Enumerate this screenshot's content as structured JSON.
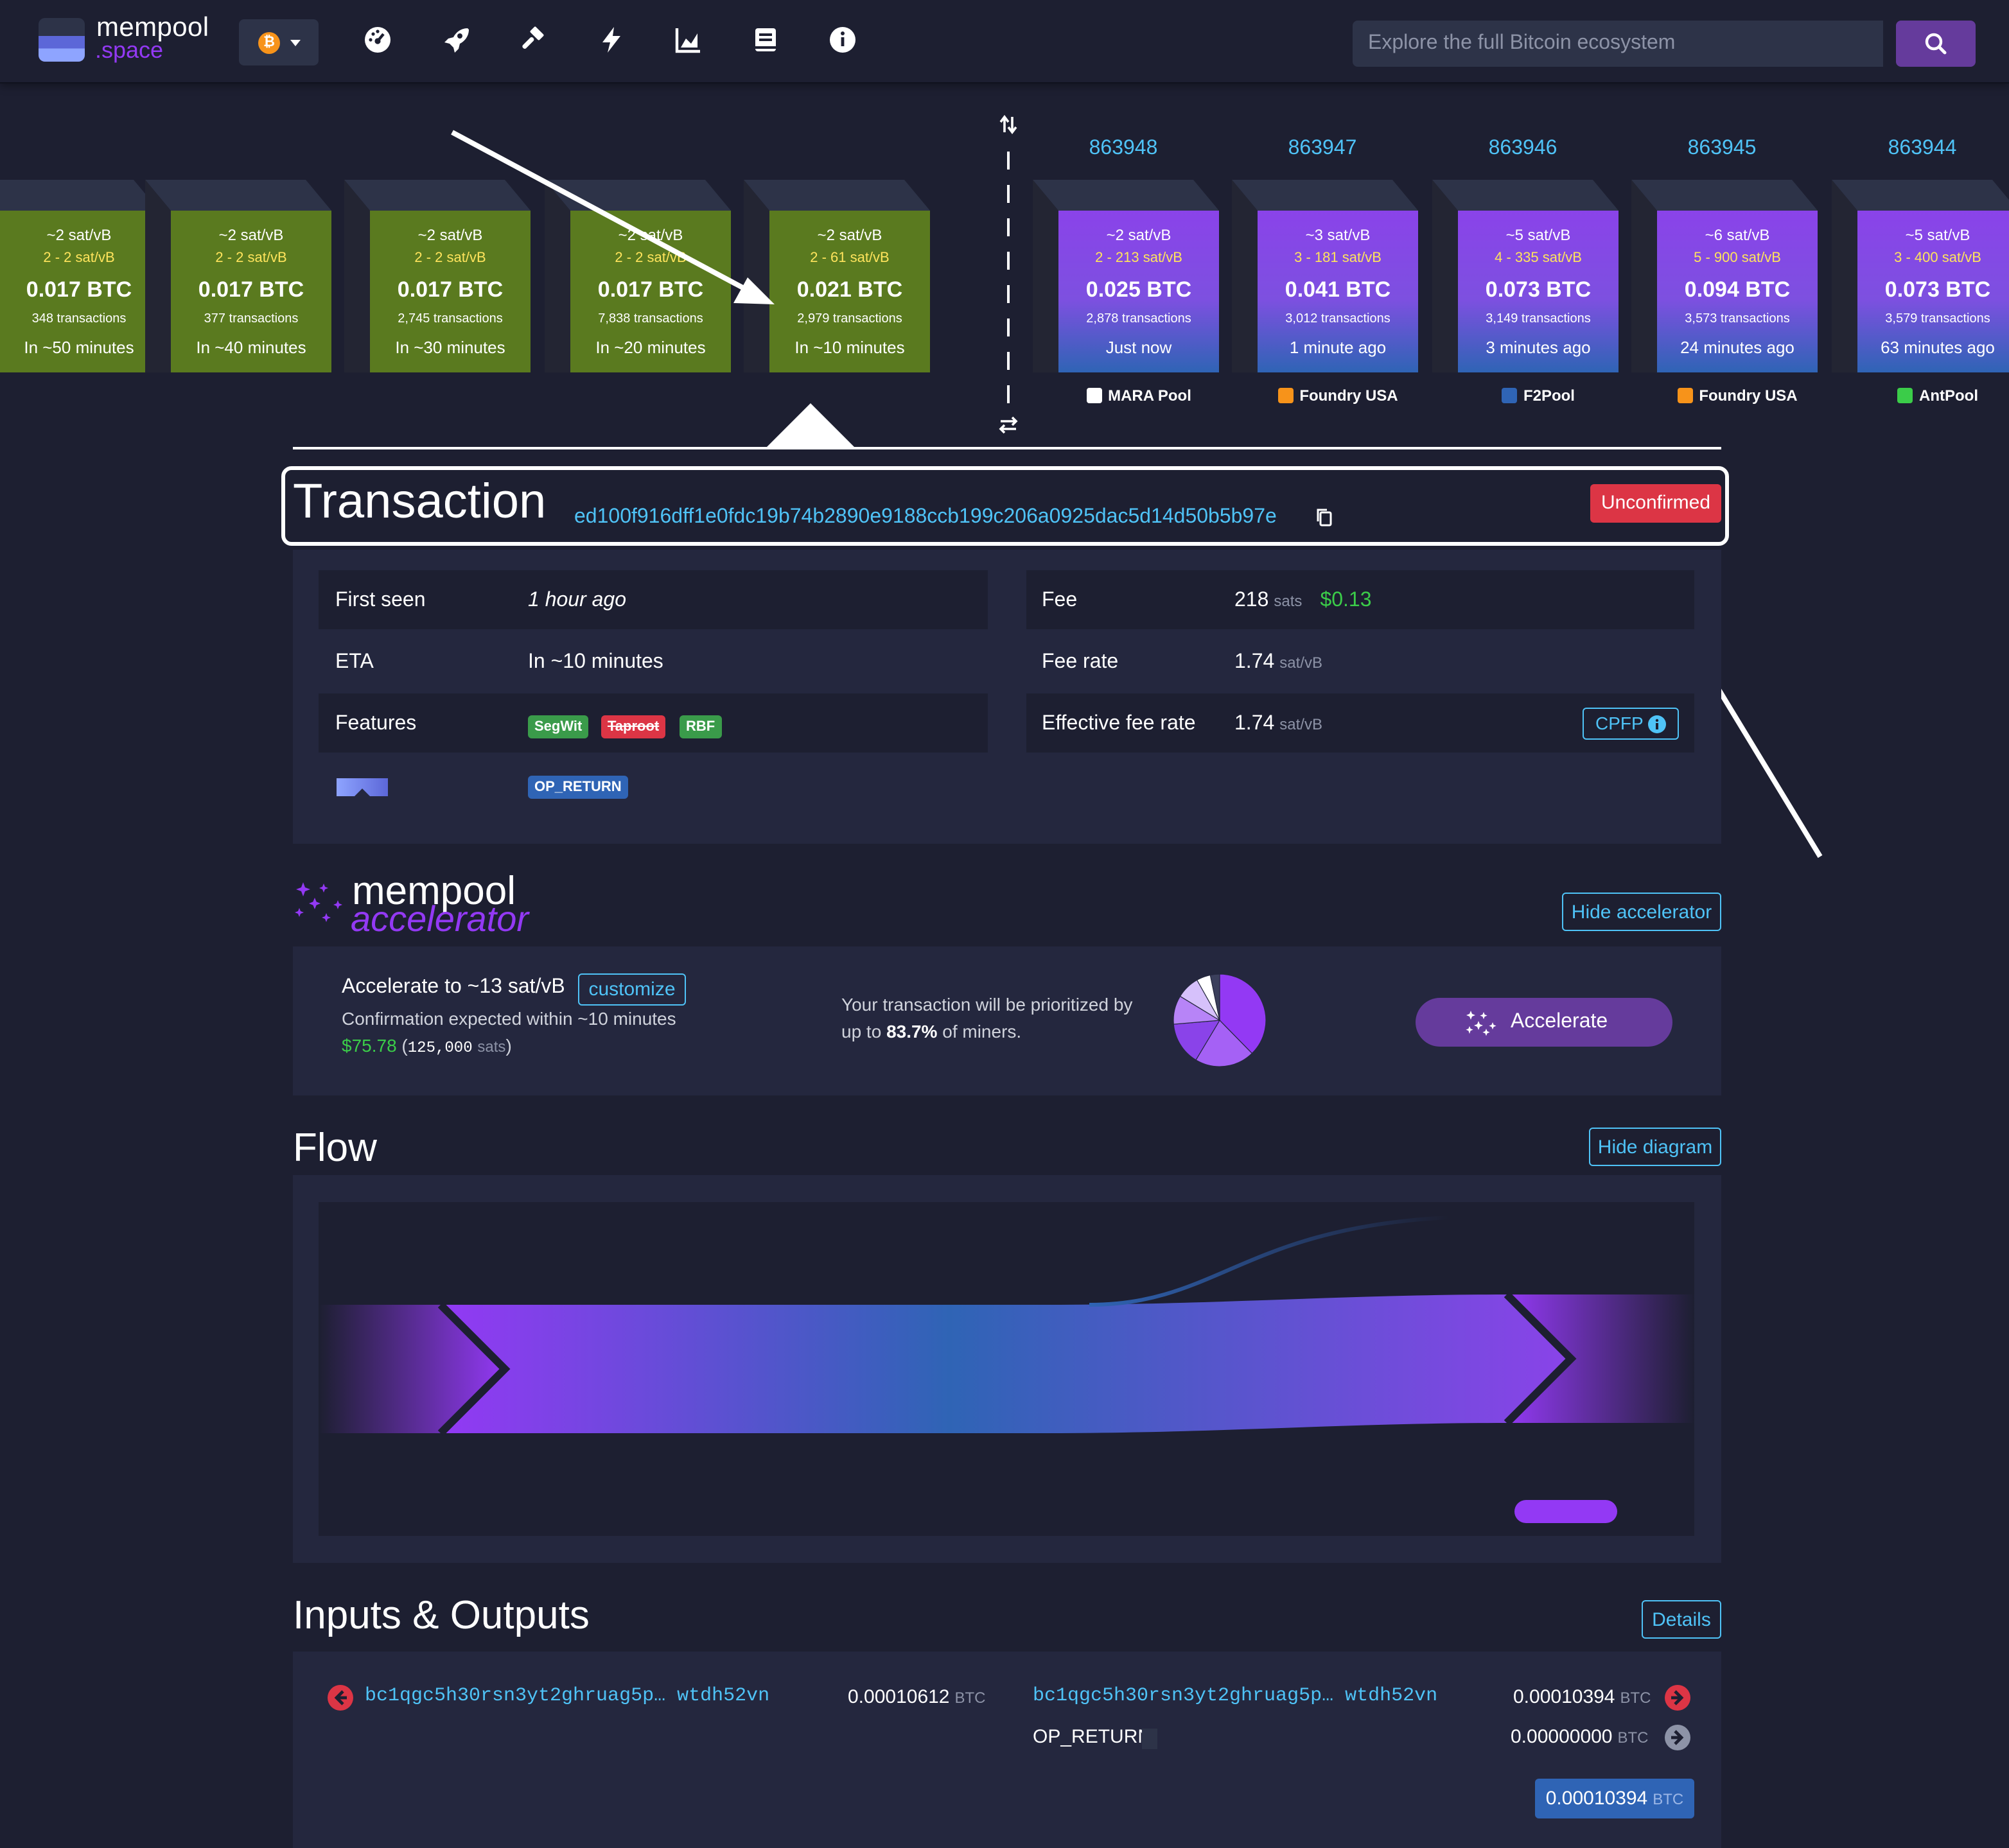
{
  "nav": {
    "logo_line1": "mempool",
    "logo_line2": ".space",
    "network_symbol": "₿",
    "icons": [
      "dashboard-icon",
      "rocket-icon",
      "hammer-icon",
      "lightning-icon",
      "chart-icon",
      "docs-icon",
      "info-icon"
    ],
    "search_placeholder": "Explore the full Bitcoin ecosystem"
  },
  "mempool_blocks": [
    {
      "median": "~2 sat/vB",
      "range": "2 - 2 sat/vB",
      "size": "0.017 BTC",
      "txs": "348 transactions",
      "eta": "In ~50 minutes"
    },
    {
      "median": "~2 sat/vB",
      "range": "2 - 2 sat/vB",
      "size": "0.017 BTC",
      "txs": "377 transactions",
      "eta": "In ~40 minutes"
    },
    {
      "median": "~2 sat/vB",
      "range": "2 - 2 sat/vB",
      "size": "0.017 BTC",
      "txs": "2,745 transactions",
      "eta": "In ~30 minutes"
    },
    {
      "median": "~2 sat/vB",
      "range": "2 - 2 sat/vB",
      "size": "0.017 BTC",
      "txs": "7,838 transactions",
      "eta": "In ~20 minutes"
    },
    {
      "median": "~2 sat/vB",
      "range": "2 - 61 sat/vB",
      "size": "0.021 BTC",
      "txs": "2,979 transactions",
      "eta": "In ~10 minutes"
    }
  ],
  "mined_blocks": [
    {
      "height": "863948",
      "median": "~2 sat/vB",
      "range": "2 - 213 sat/vB",
      "size": "0.025 BTC",
      "txs": "2,878 transactions",
      "time": "Just now",
      "pool": "MARA Pool"
    },
    {
      "height": "863947",
      "median": "~3 sat/vB",
      "range": "3 - 181 sat/vB",
      "size": "0.041 BTC",
      "txs": "3,012 transactions",
      "time": "1 minute ago",
      "pool": "Foundry USA"
    },
    {
      "height": "863946",
      "median": "~5 sat/vB",
      "range": "4 - 335 sat/vB",
      "size": "0.073 BTC",
      "txs": "3,149 transactions",
      "time": "3 minutes ago",
      "pool": "F2Pool"
    },
    {
      "height": "863945",
      "median": "~6 sat/vB",
      "range": "5 - 900 sat/vB",
      "size": "0.094 BTC",
      "txs": "3,573 transactions",
      "time": "24 minutes ago",
      "pool": "Foundry USA"
    },
    {
      "height": "863944",
      "median": "~5 sat/vB",
      "range": "3 - 400 sat/vB",
      "size": "0.073 BTC",
      "txs": "3,579 transactions",
      "time": "63 minutes ago",
      "pool": "AntPool"
    }
  ],
  "transaction": {
    "title": "Transaction",
    "txid": "ed100f916dff1e0fdc19b74b2890e9188ccb199c206a0925dac5d14d50b5b97e",
    "status": "Unconfirmed",
    "first_seen_label": "First seen",
    "first_seen": "1 hour ago",
    "eta_label": "ETA",
    "eta": "In ~10 minutes",
    "features_label": "Features",
    "features": [
      "SegWit",
      "Taproot",
      "RBF"
    ],
    "op_return": "OP_RETURN",
    "fee_label": "Fee",
    "fee": "218",
    "fee_unit": "sats",
    "fee_usd": "$0.13",
    "fee_rate_label": "Fee rate",
    "fee_rate": "1.74",
    "rate_unit": "sat/vB",
    "eff_rate_label": "Effective fee rate",
    "eff_rate": "1.74",
    "cpfp": "CPFP"
  },
  "accelerator": {
    "brand1": "mempool",
    "brand2": "accelerator",
    "hide_button": "Hide accelerator",
    "accelerate_to": "Accelerate to ~13 sat/vB",
    "customize": "customize",
    "confirmation": "Confirmation expected within ~10 minutes",
    "price_usd": "$75.78",
    "price_sats": "125,000",
    "price_sats_unit": "sats",
    "prio_text": "Your transaction will be prioritized by",
    "prio_pre": "up to",
    "prio_pct": "83.7%",
    "prio_post": "of miners.",
    "miners_share": 83.7,
    "accelerate_button": "Accelerate"
  },
  "flow": {
    "title": "Flow",
    "hide_button": "Hide diagram"
  },
  "io": {
    "title": "Inputs & Outputs",
    "details_button": "Details",
    "input_addr": "bc1qgc5h30rsn3yt2ghruag5p… wtdh52vn",
    "input_amount": "0.00010612",
    "output_addr": "bc1qgc5h30rsn3yt2ghruag5p… wtdh52vn",
    "output_amount": "0.00010394",
    "op_return_label": "OP_RETURN",
    "op_return_amount": "0.00000000",
    "total": "0.00010394",
    "unit": "BTC"
  },
  "colors": {
    "bg": "#1d1f31",
    "panel": "#24273e",
    "mempool_block": "#5a7a1f",
    "mined_block": "#8a43e9",
    "link": "#4fc3f7",
    "status_red": "#dc3545",
    "green_usd": "#3bcc49"
  }
}
